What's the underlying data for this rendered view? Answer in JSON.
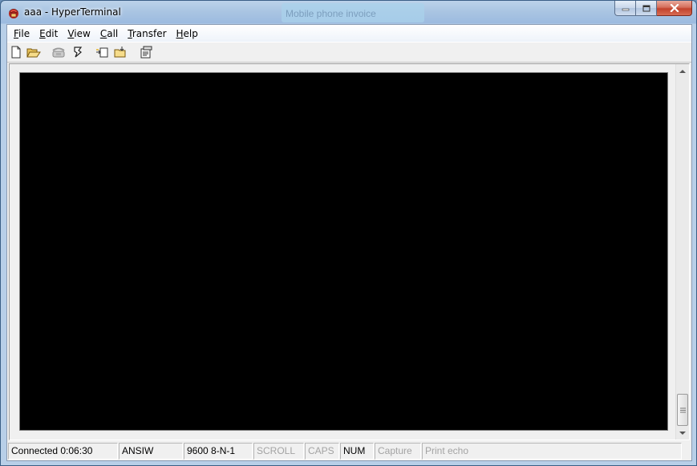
{
  "window": {
    "title": "aaa - HyperTerminal",
    "background_tab_text": "Mobile phone invoice",
    "icon": "hyperterminal-phone-icon"
  },
  "caption_buttons": {
    "minimize_icon": "minimize-icon",
    "maximize_icon": "maximize-icon",
    "close_icon": "close-icon"
  },
  "menu": {
    "items": [
      {
        "label": "File"
      },
      {
        "label": "Edit"
      },
      {
        "label": "View"
      },
      {
        "label": "Call"
      },
      {
        "label": "Transfer"
      },
      {
        "label": "Help"
      }
    ]
  },
  "toolbar": {
    "buttons": [
      {
        "icon": "new-document-icon"
      },
      {
        "icon": "open-folder-icon"
      },
      {
        "icon": "connect-phone-icon"
      },
      {
        "icon": "disconnect-icon"
      },
      {
        "icon": "send-file-icon"
      },
      {
        "icon": "receive-file-icon"
      },
      {
        "icon": "properties-icon"
      }
    ]
  },
  "terminal": {
    "background": "#000000",
    "content": ""
  },
  "statusbar": {
    "connection": "Connected 0:06:30",
    "emulation": "ANSIW",
    "settings": "9600 8-N-1",
    "scroll": "SCROLL",
    "caps": "CAPS",
    "num": "NUM",
    "capture": "Capture",
    "print_echo": "Print echo"
  },
  "colors": {
    "title_bar": "#a9c4e2",
    "close_button": "#c2432c",
    "disabled_text": "#a3a3a3"
  }
}
